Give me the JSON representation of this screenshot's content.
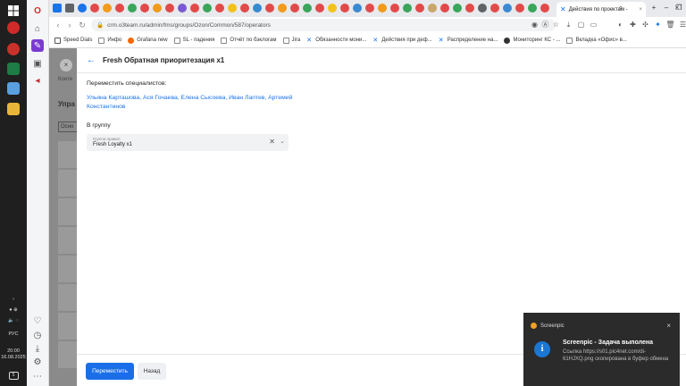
{
  "taskbar": {
    "lang": "РУС",
    "time": "20:00",
    "date": "16.08.2025",
    "notification_count": "5"
  },
  "browser": {
    "active_tab_title": "Действия по проектам -",
    "url": "crm.o3team.ru/admin/fms/groups/Ozon/Common/587/operators"
  },
  "bookmarks": [
    {
      "label": "Speed Dials",
      "color": "#555555"
    },
    {
      "label": "Инфо",
      "color": "#888888"
    },
    {
      "label": "Grafana new",
      "color": "#f46800"
    },
    {
      "label": "SL - падения",
      "color": "#888888"
    },
    {
      "label": "Отчёт по бэклогам",
      "color": "#888888"
    },
    {
      "label": "Jira",
      "color": "#888888"
    },
    {
      "label": "Обязанности мони...",
      "color": "#1a73e8"
    },
    {
      "label": "Действия при деф...",
      "color": "#1a73e8"
    },
    {
      "label": "Распределение на...",
      "color": "#1a73e8"
    },
    {
      "label": "Мониторинг КС - ...",
      "color": "#555555"
    },
    {
      "label": "Вкладка «Офис» в...",
      "color": "#888888"
    }
  ],
  "background_page": {
    "breadcrumb": "Конте",
    "heading": "Упра",
    "tab": "Осно"
  },
  "drawer": {
    "title": "Fresh Обратная приоритезация x1",
    "move_label": "Переместить специалистов:",
    "specialists": "Ульяна Карташова, Ася Гочаева, Елена Сысоева, Иван Лаптев, Артемий Константинов",
    "group_label": "В группу",
    "select_caption": "Группа правил",
    "select_value": "Fresh Loyalty x1",
    "primary_button": "Переместить",
    "secondary_button": "Назад"
  },
  "notification": {
    "app": "Screenpic",
    "title": "Screenpic - Задача выполена",
    "body": "Ссылка https://s01.pic4net.com/di-61HJXQ.png скопирована в буфер обмена"
  }
}
